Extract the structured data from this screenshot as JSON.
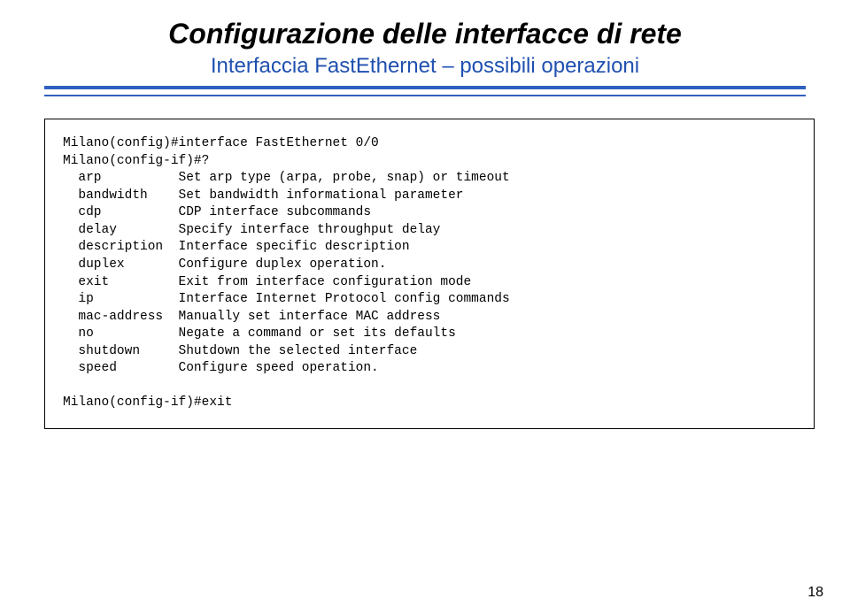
{
  "title": "Configurazione delle interfacce di rete",
  "subtitle": "Interfaccia FastEthernet – possibili operazioni",
  "code": {
    "line1": "Milano(config)#interface FastEthernet 0/0",
    "line2": "Milano(config-if)#?",
    "rows": [
      {
        "cmd": "arp",
        "desc": "Set arp type (arpa, probe, snap) or timeout"
      },
      {
        "cmd": "bandwidth",
        "desc": "Set bandwidth informational parameter"
      },
      {
        "cmd": "cdp",
        "desc": "CDP interface subcommands"
      },
      {
        "cmd": "delay",
        "desc": "Specify interface throughput delay"
      },
      {
        "cmd": "description",
        "desc": "Interface specific description"
      },
      {
        "cmd": "duplex",
        "desc": "Configure duplex operation."
      },
      {
        "cmd": "exit",
        "desc": "Exit from interface configuration mode"
      },
      {
        "cmd": "ip",
        "desc": "Interface Internet Protocol config commands"
      },
      {
        "cmd": "mac-address",
        "desc": "Manually set interface MAC address"
      },
      {
        "cmd": "no",
        "desc": "Negate a command or set its defaults"
      },
      {
        "cmd": "shutdown",
        "desc": "Shutdown the selected interface"
      },
      {
        "cmd": "speed",
        "desc": "Configure speed operation."
      }
    ],
    "line_last": "Milano(config-if)#exit"
  },
  "page_number": "18"
}
